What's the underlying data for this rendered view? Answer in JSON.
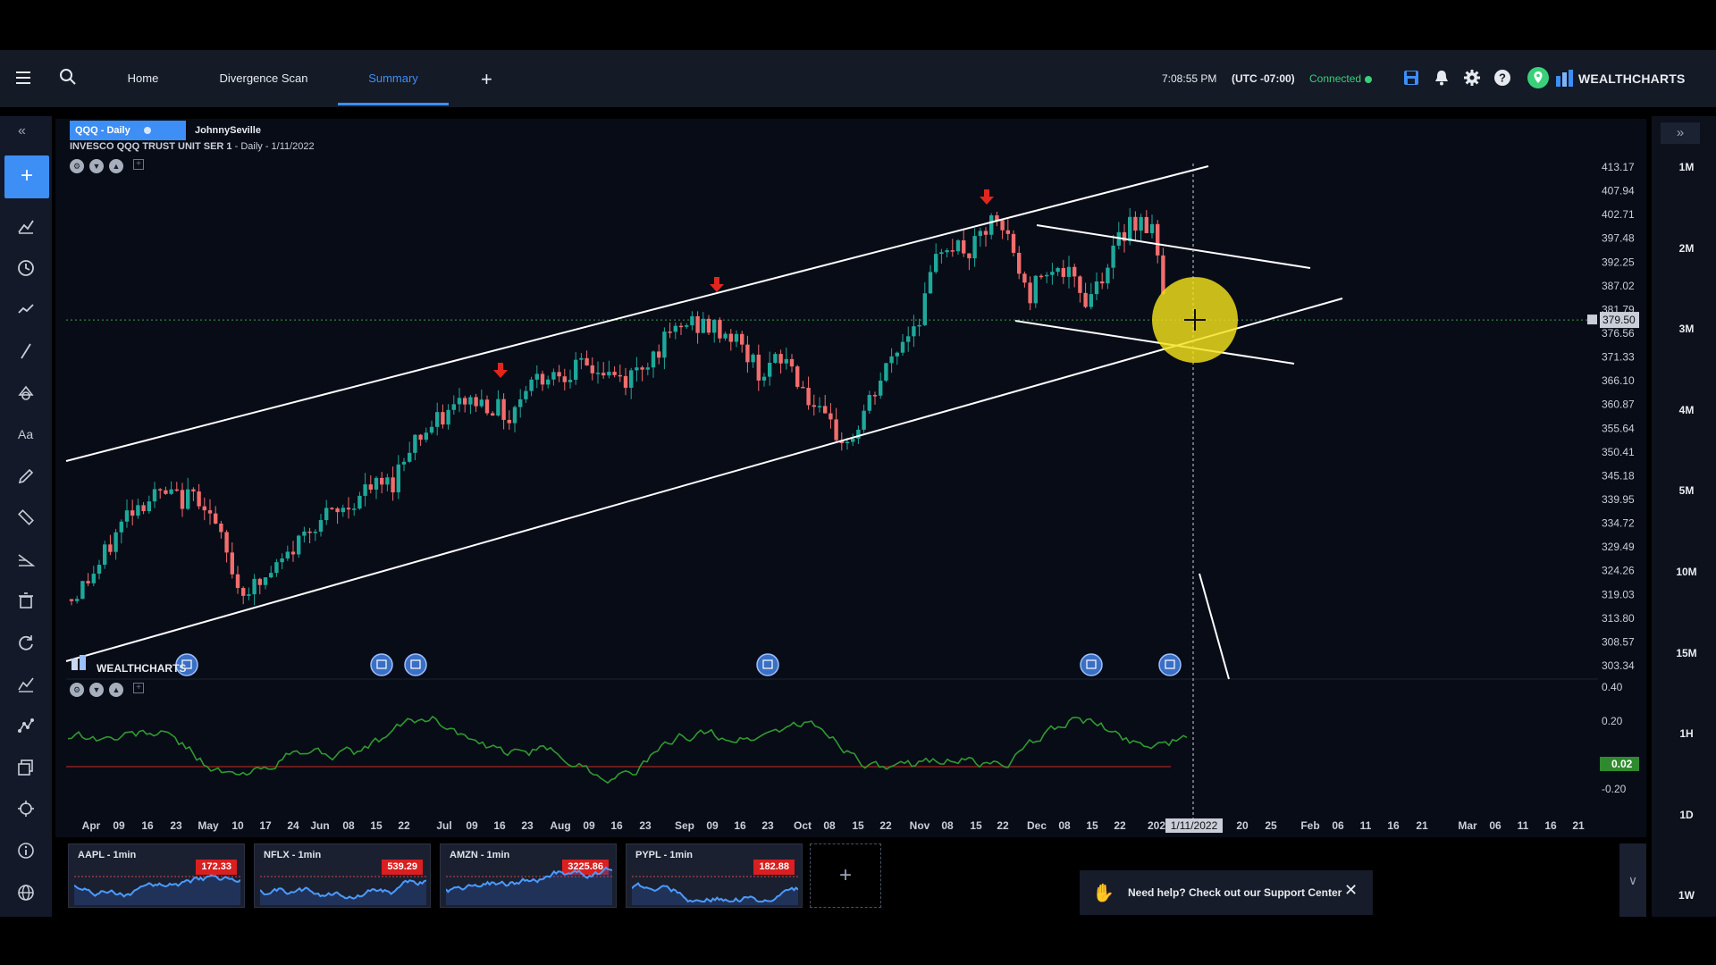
{
  "nav": {
    "tabs": [
      {
        "label": "Home"
      },
      {
        "label": "Divergence Scan"
      },
      {
        "label": "Summary"
      }
    ],
    "time": "7:08:55 PM",
    "timezone": "(UTC -07:00)",
    "connection_status": "Connected",
    "brand": "WEALTHCHARTS",
    "icons": [
      "hamburger-icon",
      "search-icon",
      "plus-icon",
      "save-icon",
      "bell-icon",
      "gear-icon",
      "help-icon",
      "location-icon"
    ],
    "colors": {
      "accent": "#3d8ef5",
      "connected": "#3ad07a"
    }
  },
  "left_toolbar": {
    "icons": [
      "collapse-left-icon",
      "crosshair-add-icon",
      "indicator-icon",
      "clock-icon",
      "trend-icon",
      "line-icon",
      "shapes-icon",
      "text-icon",
      "pencil-icon",
      "ruler-icon",
      "fib-icon",
      "trash-icon",
      "refresh-icon",
      "chart-line-icon",
      "pattern-icon",
      "layers-icon",
      "target-icon",
      "info-icon",
      "globe-icon"
    ]
  },
  "timeframes": [
    "1M",
    "2M",
    "3M",
    "4M",
    "5M",
    "10M",
    "15M",
    "1H",
    "1D",
    "1W"
  ],
  "chart": {
    "symbol_tab": "QQQ - Daily",
    "user_tab": "JohnnySeville",
    "instrument": "INVESCO QQQ TRUST UNIT SER 1",
    "period": "- Daily - 1/11/2022",
    "watermark": "WEALTHCHARTS",
    "price_axis": [
      "413.17",
      "407.94",
      "402.71",
      "397.48",
      "392.25",
      "387.02",
      "381.79",
      "376.56",
      "371.33",
      "366.10",
      "360.87",
      "355.64",
      "350.41",
      "345.18",
      "339.95",
      "334.72",
      "329.49",
      "324.26",
      "319.03",
      "313.80",
      "308.57",
      "303.34"
    ],
    "current_price": "379.50",
    "oscillator_axis": [
      "0.40",
      "0.20",
      "-0.20"
    ],
    "oscillator_value": "0.02",
    "date_axis": [
      "Apr",
      "09",
      "16",
      "23",
      "May",
      "10",
      "17",
      "24",
      "Jun",
      "08",
      "15",
      "22",
      "Jul",
      "09",
      "16",
      "23",
      "Aug",
      "09",
      "16",
      "23",
      "Sep",
      "09",
      "16",
      "23",
      "Oct",
      "08",
      "15",
      "22",
      "Nov",
      "08",
      "15",
      "22",
      "Dec",
      "08",
      "15",
      "22",
      "202",
      "20",
      "25",
      "Feb",
      "06",
      "11",
      "16",
      "21",
      "Mar",
      "06",
      "11",
      "16",
      "21"
    ],
    "cursor_date": "1/11/2022",
    "colors": {
      "up": "#1ea89a",
      "down": "#f26d6d",
      "oscillator": "#2f9a2f",
      "zero_line": "#8b1e1e",
      "highlight": "#f3e21b"
    }
  },
  "chart_data": {
    "type": "candlestick",
    "title": "INVESCO QQQ TRUST UNIT SER 1 - Daily - 1/11/2022",
    "ylim": [
      303.34,
      413.17
    ],
    "x": [
      "Apr",
      "May",
      "Jun",
      "Jul",
      "Aug",
      "Sep",
      "Oct",
      "Nov",
      "Dec",
      "Jan"
    ],
    "approx_close": [
      318,
      336,
      326,
      343,
      369,
      378,
      357,
      392,
      390,
      380
    ],
    "last": 379.5
  },
  "tickers": [
    {
      "name": "AAPL - 1min",
      "price": "172.33"
    },
    {
      "name": "NFLX - 1min",
      "price": "539.29"
    },
    {
      "name": "AMZN - 1min",
      "price": "3225.86"
    },
    {
      "name": "PYPL - 1min",
      "price": "182.88"
    }
  ],
  "help": {
    "text": "Need help? Check out our Support Center"
  }
}
